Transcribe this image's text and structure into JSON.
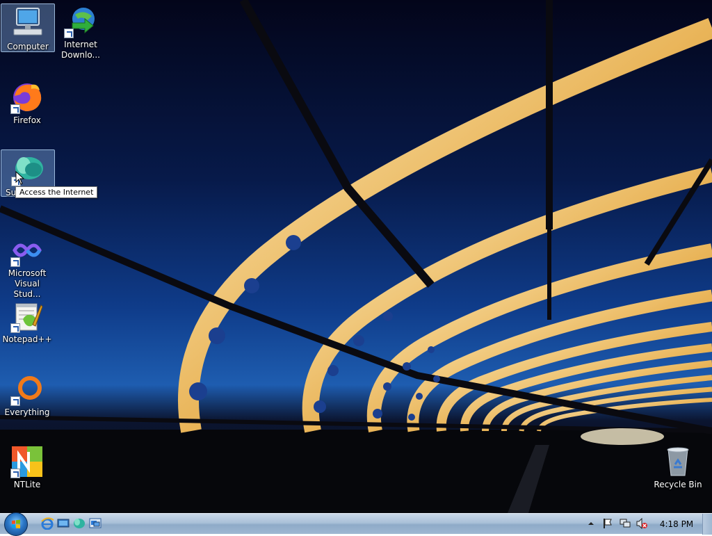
{
  "desktop": {
    "icons": [
      {
        "label": "Computer",
        "icon": "computer-icon"
      },
      {
        "label": "Internet Downlo...",
        "icon": "internet-download-manager-icon"
      },
      {
        "label": "Firefox",
        "icon": "firefox-icon"
      },
      {
        "label": "Su",
        "icon": "internet-browser-icon"
      },
      {
        "label": "Microsoft Visual Stud...",
        "icon": "visual-studio-icon"
      },
      {
        "label": "Notepad++",
        "icon": "notepad-plus-plus-icon"
      },
      {
        "label": "Everything",
        "icon": "everything-search-icon"
      },
      {
        "label": "NTLite",
        "icon": "ntlite-icon"
      },
      {
        "label": "Recycle Bin",
        "icon": "recycle-bin-icon"
      }
    ],
    "tooltip": "Access the Internet"
  },
  "taskbar": {
    "clock": "4:18 PM",
    "accent": "#2a77c7"
  }
}
